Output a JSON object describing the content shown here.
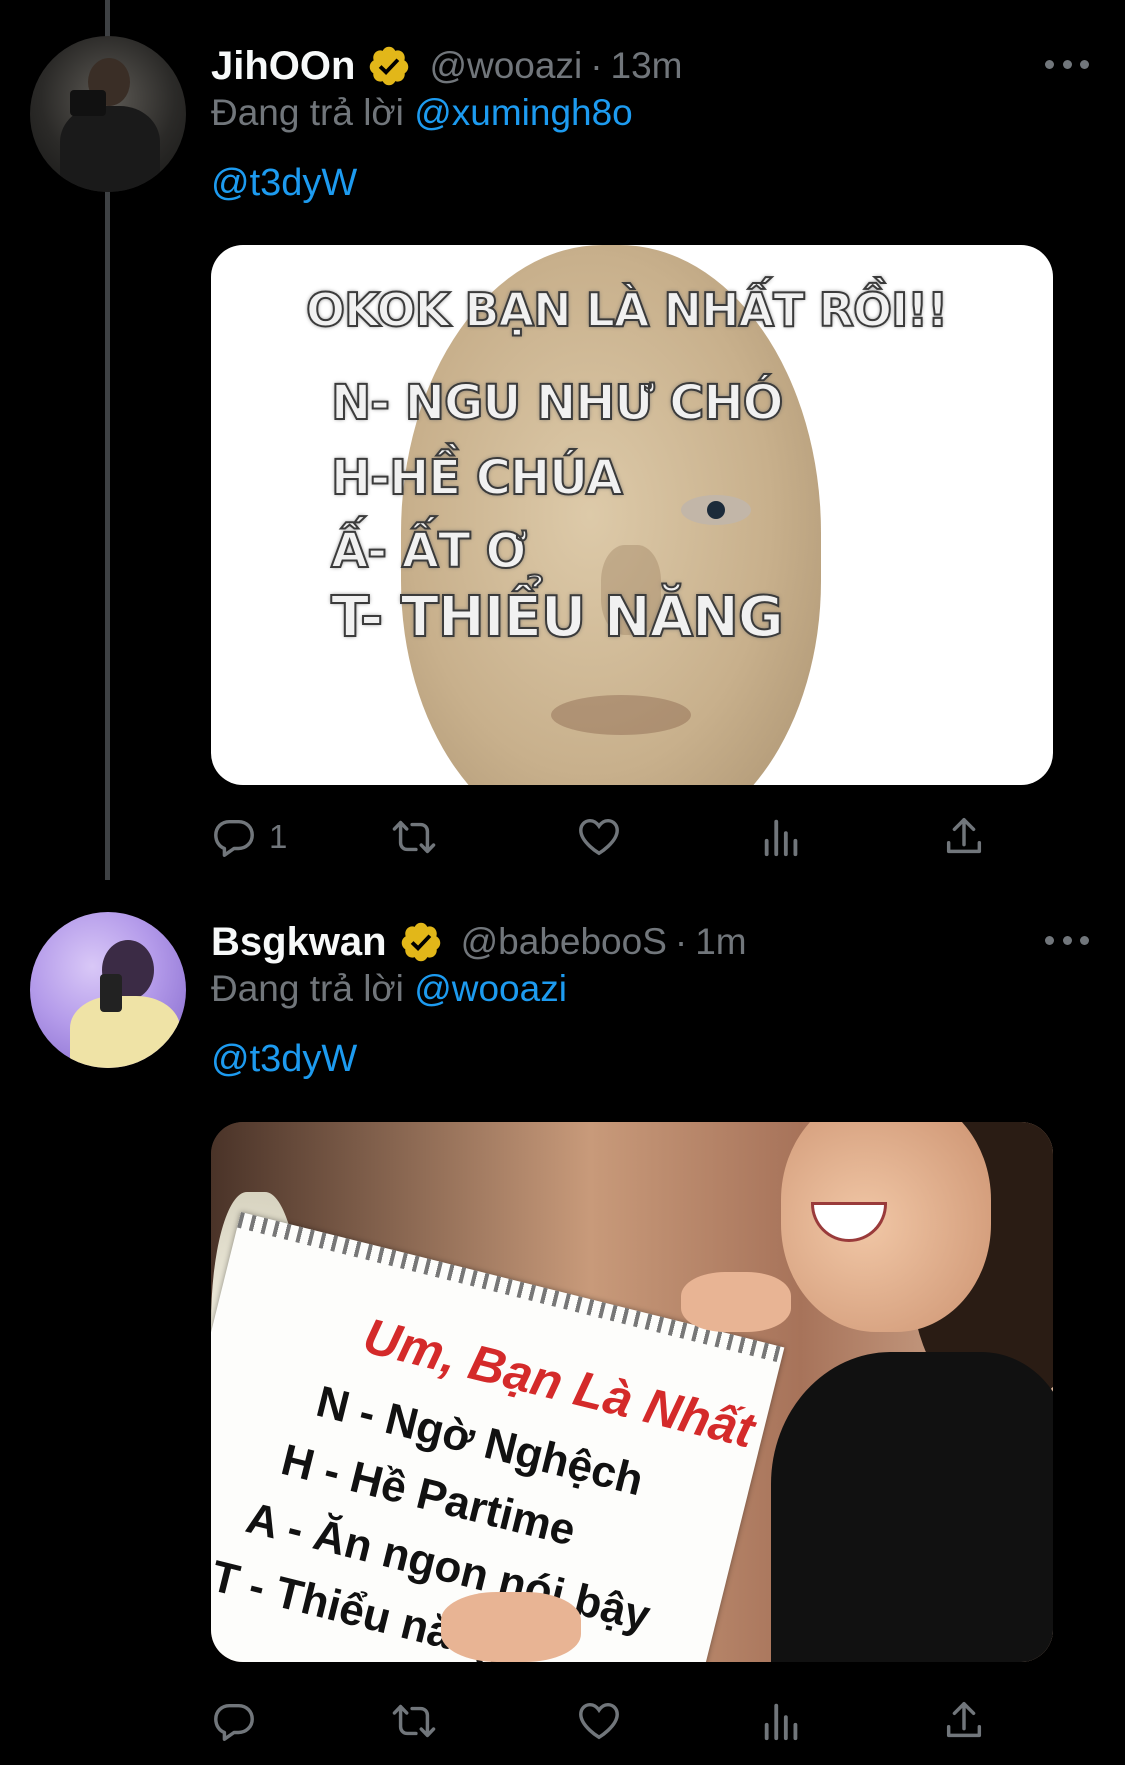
{
  "tweets": [
    {
      "name": "JihOOn",
      "handle": "@wooazi",
      "dot": "·",
      "time": "13m",
      "reply_prefix": "Đang trả lời",
      "reply_target": "@xumingh8o",
      "text": "@t3dyW",
      "image_text": {
        "title": "OKOK BẠN LÀ NHẤT RỒI!!",
        "lines": [
          "N- NGU NHƯ CHÓ",
          "H-HỀ CHÚA",
          "Ấ- ẤT Ơ",
          "T- THIỂU NĂNG"
        ]
      },
      "actions": {
        "reply_count": "1",
        "retweet_count": "",
        "like_count": ""
      }
    },
    {
      "name": "Bsgkwan",
      "handle": "@babebooS",
      "dot": "·",
      "time": "1m",
      "reply_prefix": "Đang trả lời",
      "reply_target": "@wooazi",
      "text": "@t3dyW",
      "image_text": {
        "title": "Um, Bạn Là Nhất",
        "lines": [
          "N - Ngờ Nghệch",
          "H - Hề Partime",
          "A - Ăn ngon nói bậy",
          "T - Thiểu năng"
        ]
      },
      "actions": {
        "reply_count": "",
        "retweet_count": "",
        "like_count": ""
      }
    }
  ],
  "icons": {
    "verified": "verified-badge-icon",
    "more": "more-icon",
    "reply": "reply-icon",
    "retweet": "retweet-icon",
    "like": "heart-icon",
    "views": "views-icon",
    "share": "share-icon"
  },
  "colors": {
    "background": "#000000",
    "text": "#e7e9ea",
    "muted": "#71767b",
    "link": "#1d9bf0",
    "verified": "#e2b719",
    "thread_line": "#3e4144"
  }
}
